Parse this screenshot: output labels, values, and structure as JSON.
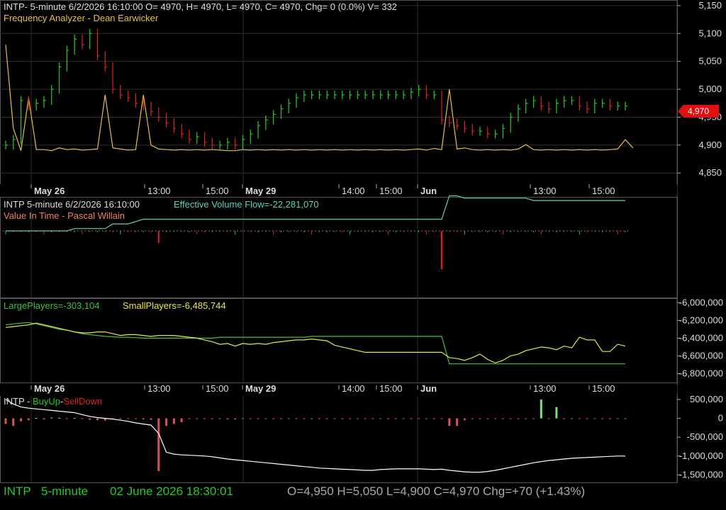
{
  "header": {
    "title": "INTP- 5-minute 6/2/2026 16:10:00 O= 4970, H= 4970, L= 4970, C= 4970, Chg= 0 (0.0%) V= 332",
    "indicator1": "Frequency Analyzer - Dean Earwicker"
  },
  "price_tag": "4,970",
  "pane2": {
    "title": "INTP 5-minute  6/2/2026 16:10:00",
    "evf": "Effective Volume Flow=-22,281,070",
    "vit": "Value In Time - Pascal Willain"
  },
  "pane3": {
    "large": "LargePlayers=-303,104",
    "small": "SmallPlayers=-6,485,744"
  },
  "pane4": {
    "label": "INTP - ",
    "buy": "BuyUp",
    "dash": "-",
    "sell": "SellDown"
  },
  "status": {
    "symbol": "INTP",
    "interval": "5-minute",
    "datetime": "02 June 2026 18:30:01",
    "ohlc": "O=4,950  H=5,050  L=4,900  C=4,970  Chg=+70 (+1.43%)"
  },
  "colors": {
    "up": "#22cc22",
    "down": "#dd2222",
    "oscillator": "#e8c040",
    "flow": "#5fd0c0",
    "large": "#40c040",
    "small": "#e8e840",
    "grid": "#2e2e2e",
    "axis_text": "#dddddd",
    "cumulative": "#ffffff"
  },
  "chart_data": [
    {
      "type": "candlestick",
      "name": "INTP 5-minute price",
      "x": [
        "May 26",
        "13:00",
        "15:00",
        "May 29",
        "14:00",
        "15:00",
        "Jun",
        "13:00",
        "15:00"
      ],
      "y_ticks": [
        4850,
        4900,
        4950,
        5000,
        5050,
        5100,
        5150
      ],
      "ylim": [
        4830,
        5160
      ],
      "values": [
        4900,
        4910,
        4980,
        4970,
        4975,
        4980,
        5000,
        5040,
        5070,
        5090,
        5080,
        5100,
        5060,
        5040,
        5000,
        4990,
        4985,
        4975,
        4970,
        4960,
        4950,
        4940,
        4930,
        4920,
        4910,
        4915,
        4905,
        4900,
        4900,
        4905,
        4900,
        4910,
        4920,
        4935,
        4945,
        4955,
        4965,
        4975,
        4985,
        4990,
        4990,
        4990,
        4990,
        4990,
        4990,
        4990,
        4990,
        4990,
        4990,
        4990,
        4990,
        4990,
        4990,
        4995,
        5000,
        4990,
        4990,
        4945,
        4940,
        4935,
        4930,
        4925,
        4925,
        4920,
        4920,
        4930,
        4950,
        4965,
        4975,
        4980,
        4970,
        4965,
        4975,
        4980,
        4980,
        4970,
        4965,
        4975,
        4975,
        4970,
        4970,
        4970
      ],
      "oscillator": [
        5080,
        4930,
        4890,
        4985,
        4892,
        4892,
        4890,
        4895,
        4892,
        4893,
        4891,
        4892,
        4893,
        4990,
        4895,
        4893,
        4891,
        4892,
        4990,
        4900,
        4893,
        4892,
        4891,
        4892,
        4891,
        4892,
        4891,
        4892,
        4891,
        4890,
        4890,
        4892,
        4891,
        4892,
        4891,
        4892,
        4891,
        4892,
        4891,
        4892,
        4891,
        4892,
        4891,
        4892,
        4891,
        4892,
        4891,
        4892,
        4891,
        4892,
        4891,
        4892,
        4891,
        4892,
        4893,
        4891,
        4894,
        4892,
        5000,
        4893,
        4895,
        4892,
        4891,
        4892,
        4891,
        4892,
        4891,
        4893,
        4901,
        4892,
        4891,
        4892,
        4891,
        4892,
        4891,
        4892,
        4891,
        4892,
        4891,
        4892,
        4893,
        4910,
        4895
      ]
    },
    {
      "type": "line",
      "name": "Effective Volume Flow",
      "series": [
        {
          "name": "Effective Volume Flow",
          "values": [
            0,
            0,
            0,
            0,
            0,
            0,
            0,
            0,
            0,
            -1,
            -1,
            -1,
            -1,
            -1,
            -3,
            -3,
            -3,
            -4,
            -5,
            -5,
            -5,
            -5,
            -5,
            -5,
            -5,
            -5,
            -5,
            -5,
            -5,
            -5,
            -5,
            -5,
            -5,
            -5,
            -5,
            -5,
            -5,
            -5,
            -5,
            -5,
            -5,
            -5,
            -5,
            -5,
            -5,
            -5,
            -5,
            -5,
            -5,
            -5,
            -5,
            -5,
            -5,
            -5,
            -5,
            -5,
            -5,
            -5,
            -15,
            -15,
            -14,
            -14,
            -14,
            -14,
            -14,
            -14,
            -14,
            -14,
            -14,
            -13,
            -13,
            -13,
            -13,
            -13,
            -13,
            -13,
            -13,
            -13,
            -13,
            -13,
            -13,
            -13
          ]
        }
      ]
    },
    {
      "type": "line",
      "name": "Value In Time",
      "y_ticks": [
        -6000000,
        -6200000,
        -6400000,
        -6600000,
        -6800000
      ],
      "ylim": [
        -6900000,
        -5950000
      ],
      "series": [
        {
          "name": "LargePlayers",
          "values": [
            -6250000,
            -6240000,
            -6230000,
            -6225000,
            -6240000,
            -6260000,
            -6280000,
            -6300000,
            -6310000,
            -6330000,
            -6350000,
            -6360000,
            -6370000,
            -6380000,
            -6385000,
            -6390000,
            -6390000,
            -6395000,
            -6400000,
            -6400000,
            -6400000,
            -6400000,
            -6400000,
            -6400000,
            -6400000,
            -6400000,
            -6400000,
            -6400000,
            -6390000,
            -6390000,
            -6390000,
            -6390000,
            -6390000,
            -6390000,
            -6390000,
            -6390000,
            -6390000,
            -6390000,
            -6390000,
            -6390000,
            -6380000,
            -6380000,
            -6380000,
            -6380000,
            -6380000,
            -6380000,
            -6380000,
            -6380000,
            -6380000,
            -6380000,
            -6380000,
            -6380000,
            -6380000,
            -6380000,
            -6380000,
            -6380000,
            -6380000,
            -6380000,
            -6690000,
            -6690000,
            -6690000,
            -6690000,
            -6690000,
            -6690000,
            -6690000,
            -6690000,
            -6690000,
            -6690000,
            -6690000,
            -6690000,
            -6690000,
            -6690000,
            -6690000,
            -6690000,
            -6690000,
            -6690000,
            -6690000,
            -6690000,
            -6690000,
            -6690000,
            -6690000,
            -6690000
          ]
        },
        {
          "name": "SmallPlayers",
          "values": [
            -6280000,
            -6270000,
            -6260000,
            -6250000,
            -6230000,
            -6250000,
            -6270000,
            -6290000,
            -6310000,
            -6330000,
            -6340000,
            -6340000,
            -6330000,
            -6330000,
            -6350000,
            -6370000,
            -6360000,
            -6360000,
            -6370000,
            -6380000,
            -6370000,
            -6370000,
            -6370000,
            -6380000,
            -6390000,
            -6400000,
            -6420000,
            -6440000,
            -6470000,
            -6460000,
            -6490000,
            -6460000,
            -6470000,
            -6460000,
            -6470000,
            -6450000,
            -6440000,
            -6430000,
            -6420000,
            -6420000,
            -6410000,
            -6420000,
            -6430000,
            -6480000,
            -6500000,
            -6520000,
            -6540000,
            -6560000,
            -6560000,
            -6560000,
            -6560000,
            -6560000,
            -6560000,
            -6560000,
            -6560000,
            -6560000,
            -6560000,
            -6560000,
            -6620000,
            -6630000,
            -6650000,
            -6620000,
            -6580000,
            -6640000,
            -6680000,
            -6650000,
            -6600000,
            -6580000,
            -6540000,
            -6520000,
            -6500000,
            -6510000,
            -6530000,
            -6490000,
            -6510000,
            -6390000,
            -6420000,
            -6420000,
            -6550000,
            -6550000,
            -6470000,
            -6490000
          ]
        }
      ]
    },
    {
      "type": "bar",
      "name": "BuyUp-SellDown",
      "y_ticks": [
        500000,
        0,
        -500000,
        -1000000,
        -1500000
      ],
      "ylim": [
        -1700000,
        650000
      ],
      "values": [
        -150000,
        -200000,
        -80000,
        -50000,
        10000,
        -30000,
        20000,
        15000,
        -10000,
        10000,
        -20000,
        -40000,
        -50000,
        -60000,
        -30000,
        -20000,
        -10000,
        -10000,
        -30000,
        -40000,
        -1400000,
        -200000,
        -150000,
        -100000,
        -20000,
        -10000,
        -10000,
        -10000,
        -10000,
        -30000,
        -30000,
        -10000,
        -10000,
        -10000,
        -10000,
        -10000,
        -10000,
        -10000,
        -10000,
        -10000,
        -10000,
        -10000,
        -10000,
        -10000,
        -10000,
        -10000,
        -10000,
        -10000,
        -10000,
        -10000,
        -10000,
        -10000,
        -10000,
        -10000,
        -10000,
        -10000,
        -10000,
        -10000,
        -200000,
        -200000,
        -50000,
        -10000,
        -10000,
        -10000,
        -10000,
        -10000,
        -10000,
        -10000,
        -10000,
        -10000,
        500000,
        -10000,
        300000,
        -10000,
        -10000,
        -10000,
        -10000,
        -10000,
        -10000,
        -10000,
        -10000,
        -10000
      ],
      "cumulative_name": "cumulative",
      "cumulative": [
        500000,
        380000,
        300000,
        270000,
        250000,
        230000,
        210000,
        190000,
        170000,
        150000,
        100000,
        50000,
        20000,
        0,
        -20000,
        -50000,
        -80000,
        -120000,
        -150000,
        -180000,
        -400000,
        -900000,
        -950000,
        -970000,
        -980000,
        -990000,
        -1000000,
        -1020000,
        -1050000,
        -1080000,
        -1100000,
        -1120000,
        -1140000,
        -1160000,
        -1180000,
        -1200000,
        -1220000,
        -1240000,
        -1260000,
        -1280000,
        -1300000,
        -1320000,
        -1330000,
        -1340000,
        -1350000,
        -1360000,
        -1370000,
        -1380000,
        -1380000,
        -1360000,
        -1350000,
        -1340000,
        -1340000,
        -1340000,
        -1340000,
        -1350000,
        -1360000,
        -1350000,
        -1380000,
        -1400000,
        -1420000,
        -1430000,
        -1430000,
        -1410000,
        -1380000,
        -1340000,
        -1300000,
        -1260000,
        -1220000,
        -1180000,
        -1150000,
        -1120000,
        -1100000,
        -1080000,
        -1060000,
        -1050000,
        -1040000,
        -1030000,
        -1020000,
        -1010000,
        -1000000,
        -1000000
      ]
    }
  ]
}
